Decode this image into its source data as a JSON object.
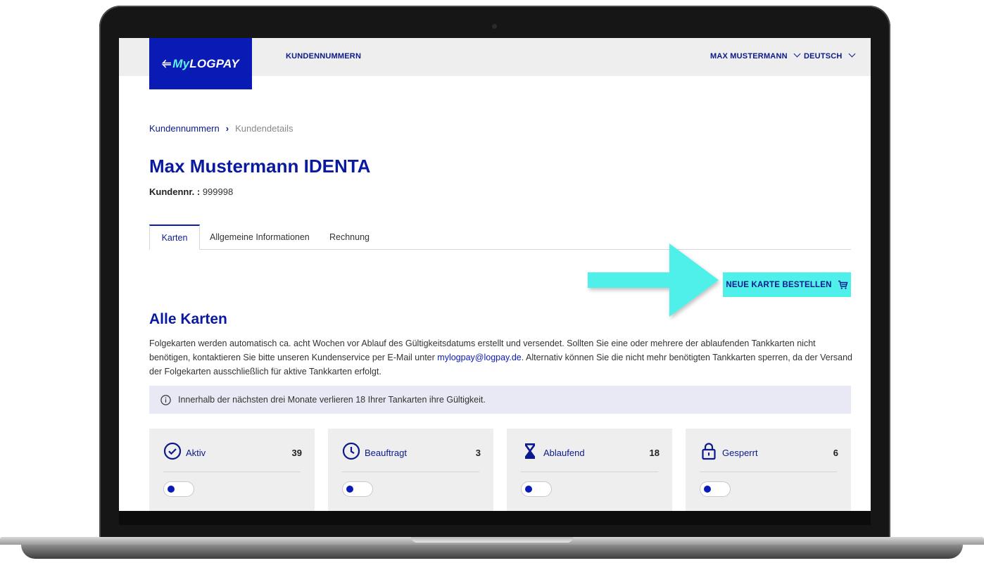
{
  "header": {
    "logo": {
      "prefix": "My",
      "suffix": "LOGPAY"
    },
    "nav_customers": "KUNDENNUMMERN",
    "user_menu": "MAX MUSTERMANN",
    "language_menu": "DEUTSCH"
  },
  "breadcrumb": {
    "parent": "Kundennummern",
    "separator": "›",
    "current": "Kundendetails"
  },
  "page": {
    "title": "Max Mustermann IDENTA",
    "customer_number_label": "Kundennr. :",
    "customer_number_value": " 999998"
  },
  "tabs": [
    {
      "label": "Karten",
      "active": true
    },
    {
      "label": "Allgemeine Informationen",
      "active": false
    },
    {
      "label": "Rechnung",
      "active": false
    }
  ],
  "order_button": {
    "label": "NEUE KARTE BESTELLEN",
    "icon": "cart-icon"
  },
  "section": {
    "title": "Alle Karten",
    "text_before_link": "Folgekarten werden automatisch ca. acht Wochen vor Ablauf des Gültigkeitsdatums erstellt und versendet. Sollten Sie eine oder mehrere der ablaufenden Tankkarten nicht benötigen, kontaktieren Sie bitte unseren Kundenservice per E-Mail unter ",
    "link": "mylogpay@logpay.de",
    "text_after_link": ". Alternativ können Sie die nicht mehr benötigten Tankkarten sperren, da der Versand der Folgekarten ausschließlich für aktive Tankkarten erfolgt."
  },
  "info_banner": {
    "icon": "info-icon",
    "text": "Innerhalb der nächsten drei Monate verlieren 18 Ihrer Tankarten ihre Gültigkeit."
  },
  "status_cards": [
    {
      "label": "Aktiv",
      "count": "39",
      "icon": "check-circle-icon",
      "toggle_on": false
    },
    {
      "label": "Beauftragt",
      "count": "3",
      "icon": "clock-icon",
      "toggle_on": false
    },
    {
      "label": "Ablaufend",
      "count": "18",
      "icon": "hourglass-icon",
      "toggle_on": false
    },
    {
      "label": "Gesperrt",
      "count": "6",
      "icon": "lock-icon",
      "toggle_on": false
    }
  ],
  "colors": {
    "brand_blue": "#0a1ab4",
    "accent_cyan": "#4ff0ea",
    "info_bg": "#e9e9f5",
    "card_bg": "#eeeeef"
  }
}
